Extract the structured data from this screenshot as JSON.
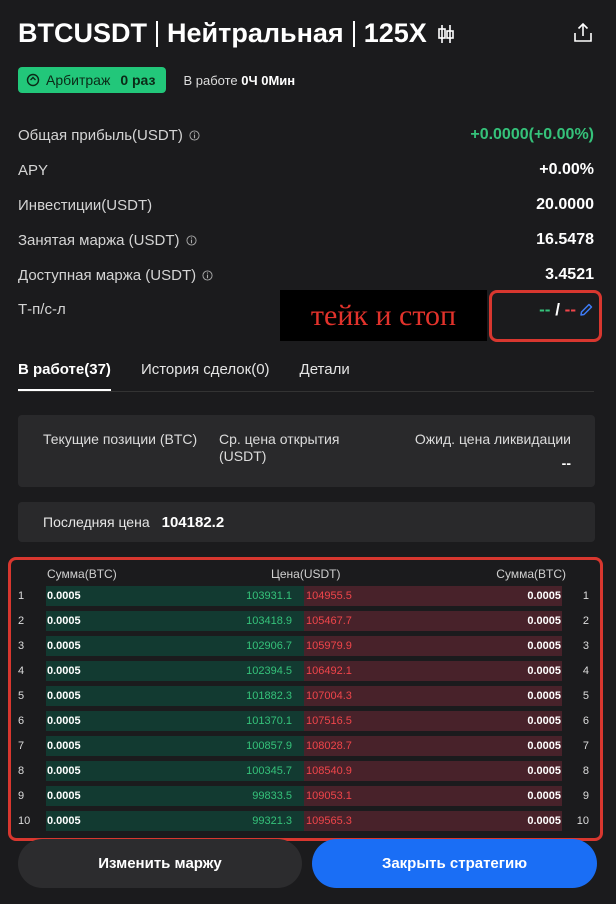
{
  "header": {
    "symbol": "BTCUSDT",
    "mode": "Нейтральная",
    "leverage": "125X",
    "icons": [
      "candlestick-icon",
      "share-icon"
    ]
  },
  "badge": {
    "label": "Арбитраж",
    "count": "0 раз"
  },
  "working": {
    "label": "В работе",
    "value": "0Ч 0Мин"
  },
  "stats": {
    "profit_label": "Общая прибыль(USDT)",
    "profit_value": "+0.0000(+0.00%)",
    "apy_label": "APY",
    "apy_value": "+0.00%",
    "invest_label": "Инвестиции(USDT)",
    "invest_value": "20.0000",
    "margin_used_label": "Занятая маржа (USDT)",
    "margin_used_value": "16.5478",
    "margin_avail_label": "Доступная маржа (USDT)",
    "margin_avail_value": "3.4521",
    "tpsl_label": "Т-п/с-л",
    "tp_value": "--",
    "slash": "/",
    "sl_value": "--"
  },
  "annotation": "тейк и стоп",
  "tabs": [
    "В работе(37)",
    "История сделок(0)",
    "Детали"
  ],
  "positions": {
    "col1": "Текущие позиции (BTC)",
    "col2": "Ср. цена открытия (USDT)",
    "col3": "Ожид. цена ликвидации",
    "col3_value": "--"
  },
  "last_price": {
    "label": "Последняя цена",
    "value": "104182.2"
  },
  "orderbook": {
    "head_left": "Сумма(BTC)",
    "head_mid": "Цена(USDT)",
    "head_right": "Сумма(BTC)",
    "rows": [
      {
        "n": "1",
        "bq": "0.0005",
        "bp": "103931.1",
        "ap": "104955.5",
        "aq": "0.0005"
      },
      {
        "n": "2",
        "bq": "0.0005",
        "bp": "103418.9",
        "ap": "105467.7",
        "aq": "0.0005"
      },
      {
        "n": "3",
        "bq": "0.0005",
        "bp": "102906.7",
        "ap": "105979.9",
        "aq": "0.0005"
      },
      {
        "n": "4",
        "bq": "0.0005",
        "bp": "102394.5",
        "ap": "106492.1",
        "aq": "0.0005"
      },
      {
        "n": "5",
        "bq": "0.0005",
        "bp": "101882.3",
        "ap": "107004.3",
        "aq": "0.0005"
      },
      {
        "n": "6",
        "bq": "0.0005",
        "bp": "101370.1",
        "ap": "107516.5",
        "aq": "0.0005"
      },
      {
        "n": "7",
        "bq": "0.0005",
        "bp": "100857.9",
        "ap": "108028.7",
        "aq": "0.0005"
      },
      {
        "n": "8",
        "bq": "0.0005",
        "bp": "100345.7",
        "ap": "108540.9",
        "aq": "0.0005"
      },
      {
        "n": "9",
        "bq": "0.0005",
        "bp": "99833.5",
        "ap": "109053.1",
        "aq": "0.0005"
      },
      {
        "n": "10",
        "bq": "0.0005",
        "bp": "99321.3",
        "ap": "109565.3",
        "aq": "0.0005"
      }
    ]
  },
  "buttons": {
    "change_margin": "Изменить маржу",
    "close_strategy": "Закрыть стратегию"
  },
  "colors": {
    "green": "#35c27a",
    "red": "#f0454a",
    "accent": "#1a6ef5",
    "badge": "#22c77a",
    "annotation": "#e2322b"
  }
}
